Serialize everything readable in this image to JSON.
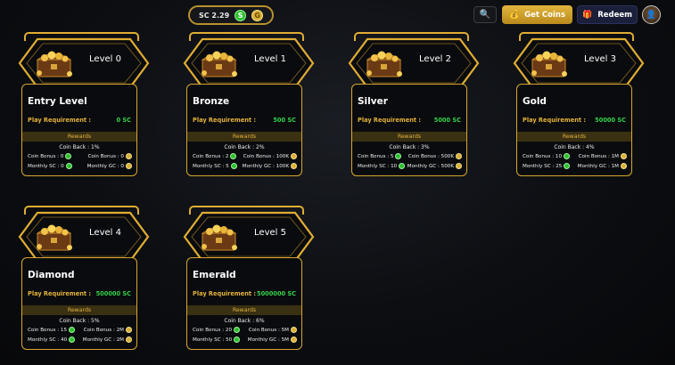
{
  "header": {
    "balance_label": "SC 2.29",
    "sc_symbol": "S",
    "gc_symbol": "G",
    "get_coins_label": "Get Coins",
    "redeem_label": "Redeem"
  },
  "rewards_label": "Rewards",
  "play_requirement_label": "Play Requirement :",
  "labels": {
    "coin_bonus": "Coin Bonus :",
    "monthly_sc": "Monthly SC :",
    "monthly_gc": "Monthly GC :"
  },
  "levels": [
    {
      "level": "Level 0",
      "name": "Entry Level",
      "requirement": "0 SC",
      "coin_back": "Coin Back : 1%",
      "sc_bonus": "Coin Bonus : 0",
      "gc_bonus": "Coin Bonus : 0",
      "monthly_sc": "Monthly SC : 0",
      "monthly_gc": "Monthly GC : 0"
    },
    {
      "level": "Level 1",
      "name": "Bronze",
      "requirement": "500 SC",
      "coin_back": "Coin Back : 2%",
      "sc_bonus": "Coin Bonus : 2",
      "gc_bonus": "Coin Bonus : 100K",
      "monthly_sc": "Monthly SC : 5",
      "monthly_gc": "Monthly GC : 100K"
    },
    {
      "level": "Level 2",
      "name": "Silver",
      "requirement": "5000 SC",
      "coin_back": "Coin Back : 3%",
      "sc_bonus": "Coin Bonus : 5",
      "gc_bonus": "Coin Bonus : 500K",
      "monthly_sc": "Monthly SC : 10",
      "monthly_gc": "Monthly GC : 500K"
    },
    {
      "level": "Level 3",
      "name": "Gold",
      "requirement": "50000 SC",
      "coin_back": "Coin Back : 4%",
      "sc_bonus": "Coin Bonus : 10",
      "gc_bonus": "Coin Bonus : 1M",
      "monthly_sc": "Monthly SC : 25",
      "monthly_gc": "Monthly GC : 1M"
    },
    {
      "level": "Level 4",
      "name": "Diamond",
      "requirement": "500000 SC",
      "coin_back": "Coin Back : 5%",
      "sc_bonus": "Coin Bonus : 15",
      "gc_bonus": "Coin Bonus : 2M",
      "monthly_sc": "Monthly SC : 40",
      "monthly_gc": "Monthly GC : 2M"
    },
    {
      "level": "Level 5",
      "name": "Emerald",
      "requirement": "5000000 SC",
      "coin_back": "Coin Back : 6%",
      "sc_bonus": "Coin Bonus : 20",
      "gc_bonus": "Coin Bonus : 5M",
      "monthly_sc": "Monthly SC : 50",
      "monthly_gc": "Monthly GC : 5M"
    }
  ],
  "colors": {
    "gold": "#e3b23c",
    "green": "#35d04a",
    "background": "#0c0e12"
  }
}
